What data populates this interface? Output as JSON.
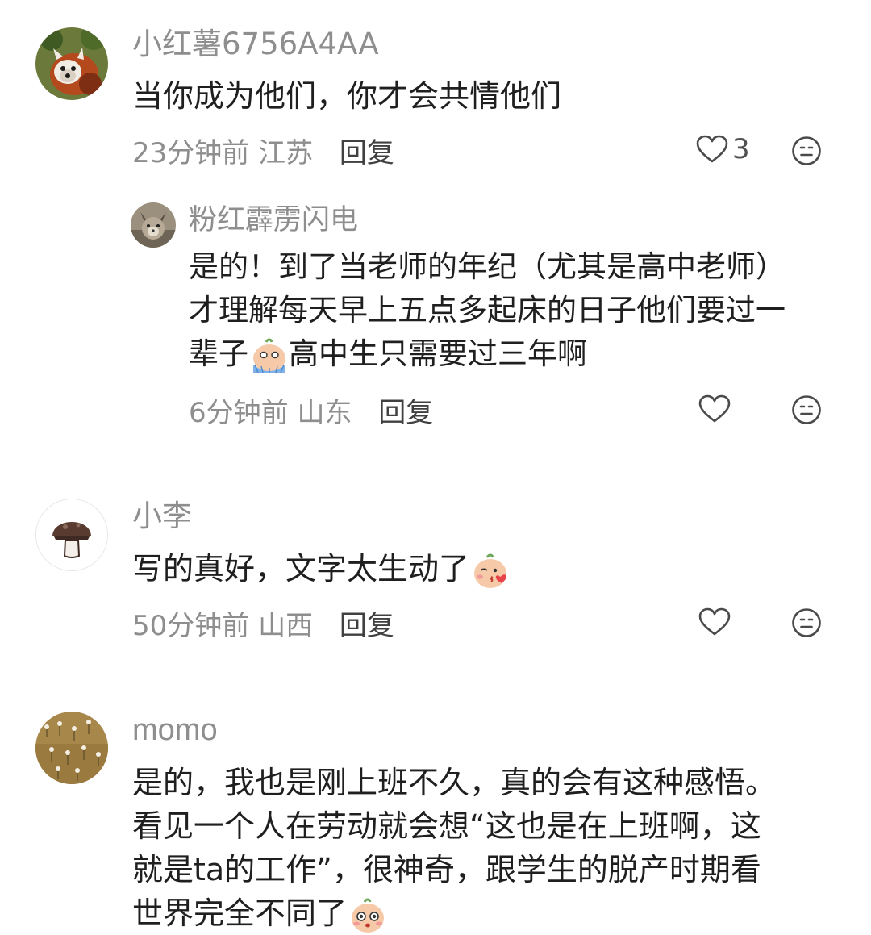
{
  "comments": [
    {
      "username": "小红薯6756A4AA",
      "text": "当你成为他们，你才会共情他们",
      "time": "23分钟前",
      "location": "江苏",
      "reply_label": "回复",
      "likes": "3",
      "avatar": "red-panda-avatar",
      "replies": [
        {
          "username": "粉红霹雳闪电",
          "text_lines": [
            "是的！到了当老师的年纪（尤其是高中老师）",
            "才理解每天早上五点多起床的日子他们要过一",
            "辈子",
            "高中生只需要过三年啊"
          ],
          "emoji": "crying-face-emoji",
          "time": "6分钟前",
          "location": "山东",
          "reply_label": "回复",
          "avatar": "cat-avatar"
        }
      ]
    },
    {
      "username": "小李",
      "text": "写的真好，文字太生动了",
      "emoji": "kiss-face-emoji",
      "time": "50分钟前",
      "location": "山西",
      "reply_label": "回复",
      "avatar": "mushroom-avatar"
    },
    {
      "username": "momo",
      "text_lines": [
        "是的，我也是刚上班不久，真的会有这种感悟。",
        "看见一个人在劳动就会想“这也是在上班啊，这",
        "就是ta的工作”，很神奇，跟学生的脱产时期看",
        "世界完全不同了"
      ],
      "emoji": "surprised-face-emoji",
      "avatar": "flower-field-avatar"
    }
  ],
  "colors": {
    "muted": "#8e8e8e",
    "text": "#1f1f1f",
    "reply": "#404040"
  }
}
